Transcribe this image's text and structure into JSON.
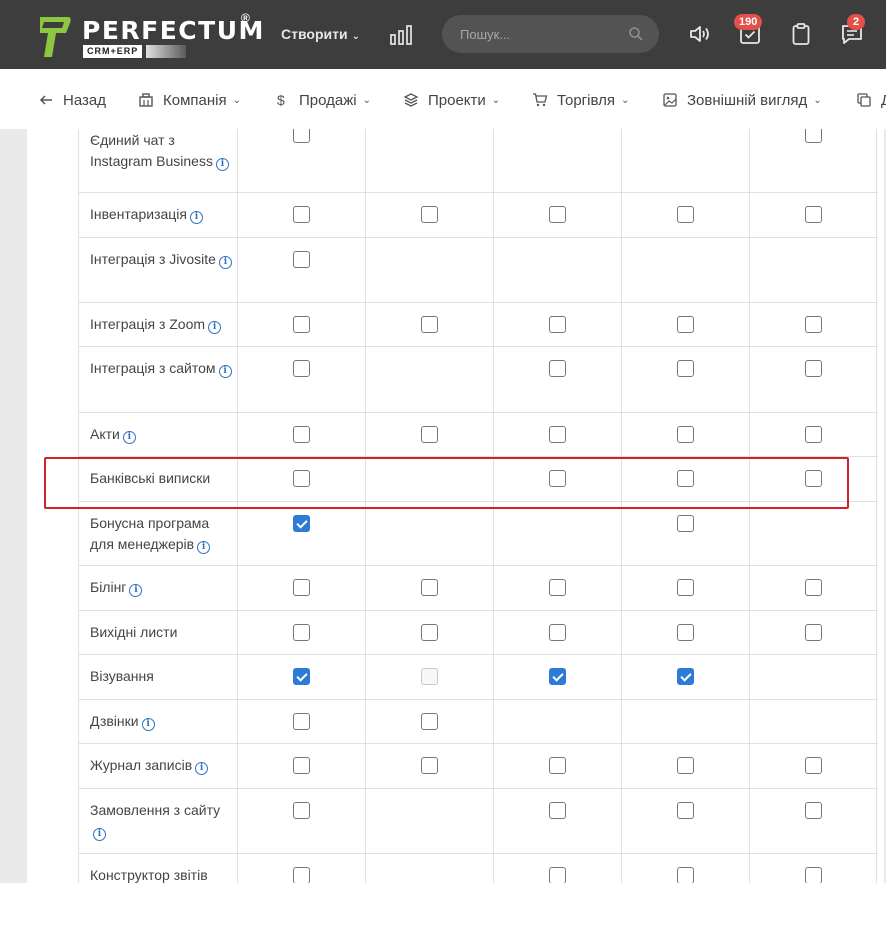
{
  "header": {
    "logo_text": "PERFECTUM",
    "logo_reg": "®",
    "logo_sub": "CRM+ERP",
    "create_label": "Створити",
    "search_placeholder": "Пошук...",
    "tasks_badge": "190",
    "messages_badge": "2",
    "colors": {
      "bg": "#3d3d3d",
      "brand_green": "#8dc63f",
      "badge": "#e2504a"
    }
  },
  "nav": {
    "items": [
      {
        "label": "Назад",
        "icon": "arrow-left-icon"
      },
      {
        "label": "Компанія",
        "icon": "building-icon"
      },
      {
        "label": "Продажі",
        "icon": "dollar-icon"
      },
      {
        "label": "Проекти",
        "icon": "layers-icon"
      },
      {
        "label": "Торгівля",
        "icon": "cart-icon"
      },
      {
        "label": "Зовнішній вигляд",
        "icon": "image-icon"
      },
      {
        "label": "Д",
        "icon": "copy-icon"
      }
    ]
  },
  "permissions": {
    "rows": [
      {
        "label": "Єдиний чат з Instagram Business",
        "info": true,
        "cells": [
          "off",
          null,
          null,
          null,
          "off"
        ]
      },
      {
        "label": "Інвентаризація",
        "info": true,
        "cells": [
          "off",
          "off",
          "off",
          "off",
          "off"
        ]
      },
      {
        "label": "Інтеграція з Jivosite",
        "info": true,
        "cells": [
          "off",
          null,
          null,
          null,
          null
        ]
      },
      {
        "label": "Інтеграція з Zoom",
        "info": true,
        "cells": [
          "off",
          "off",
          "off",
          "off",
          "off"
        ]
      },
      {
        "label": "Інтеграція з сайтом",
        "info": true,
        "cells": [
          "off",
          null,
          "off",
          "off",
          "off"
        ]
      },
      {
        "label": "Акти",
        "info": true,
        "cells": [
          "off",
          "off",
          "off",
          "off",
          "off"
        ]
      },
      {
        "label": "Банківські виписки",
        "info": false,
        "cells": [
          "off",
          null,
          "off",
          "off",
          "off"
        ]
      },
      {
        "label": "Бонусна програма для менеджерів",
        "info": true,
        "cells": [
          "on",
          null,
          null,
          "off",
          null
        ]
      },
      {
        "label": "Білінг",
        "info": true,
        "cells": [
          "off",
          "off",
          "off",
          "off",
          "off"
        ]
      },
      {
        "label": "Вихідні листи",
        "info": false,
        "cells": [
          "off",
          "off",
          "off",
          "off",
          "off"
        ]
      },
      {
        "label": "Візування",
        "info": false,
        "cells": [
          "on",
          "disabled",
          "on",
          "on",
          null
        ]
      },
      {
        "label": "Дзвінки",
        "info": true,
        "cells": [
          "off",
          "off",
          null,
          null,
          null
        ]
      },
      {
        "label": "Журнал записів",
        "info": true,
        "cells": [
          "off",
          "off",
          "off",
          "off",
          "off"
        ]
      },
      {
        "label": "Замовлення з сайту",
        "info": true,
        "cells": [
          "off",
          null,
          "off",
          "off",
          "off"
        ]
      },
      {
        "label": "Конструктор звітів",
        "info": false,
        "cells": [
          "off",
          null,
          "off",
          "off",
          "off"
        ]
      }
    ],
    "highlighted_row": "Банківські виписки",
    "colors": {
      "checked": "#2d7bd4",
      "highlight_border": "#d0212c",
      "info_icon": "#2f72c4"
    }
  }
}
